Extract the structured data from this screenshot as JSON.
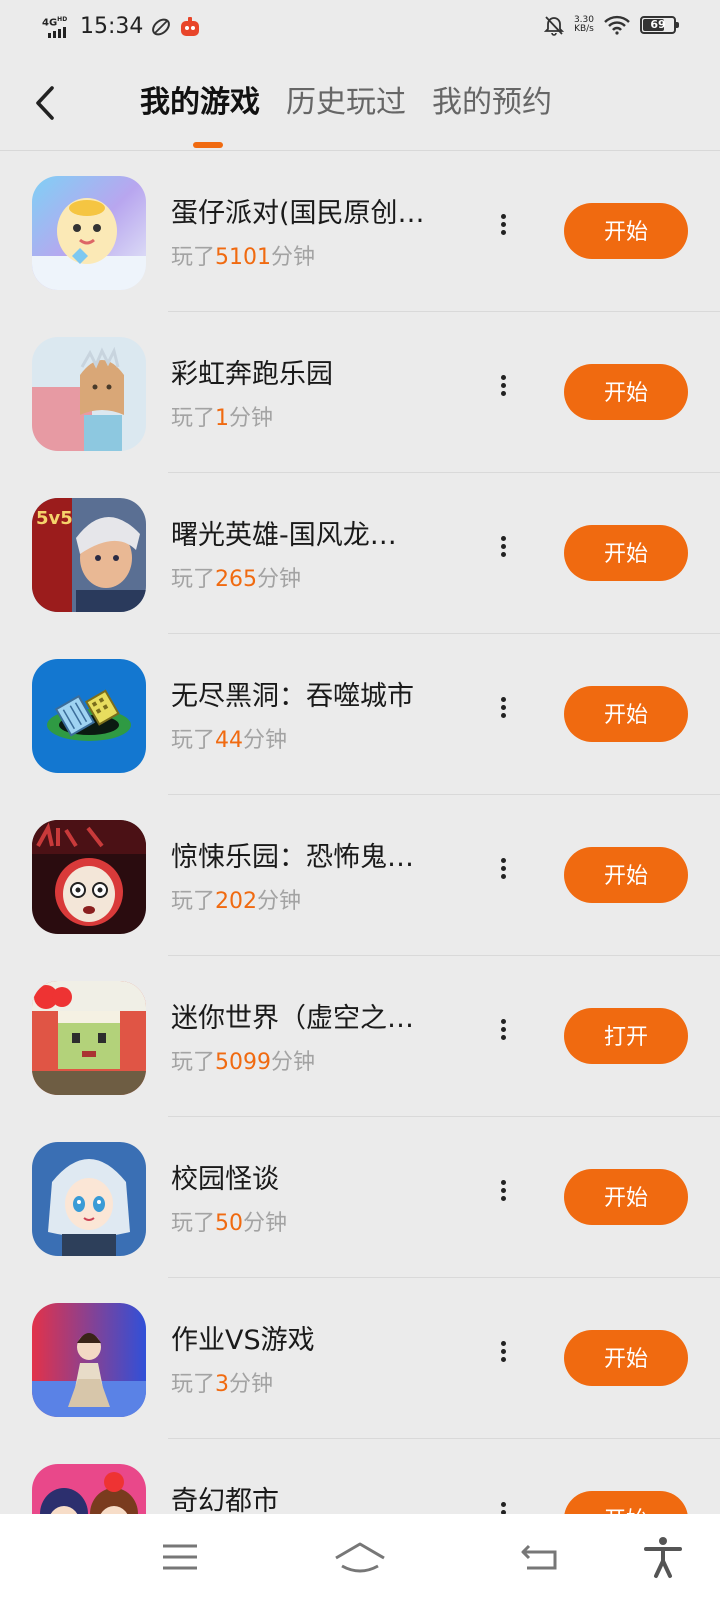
{
  "status_bar": {
    "network": "4G HD",
    "time": "15:34",
    "speed_value": "3.30",
    "speed_unit": "KB/s",
    "battery": "69"
  },
  "header": {
    "tabs": [
      {
        "label": "我的游戏",
        "active": true
      },
      {
        "label": "历史玩过",
        "active": false
      },
      {
        "label": "我的预约",
        "active": false
      }
    ]
  },
  "games": [
    {
      "title": "蛋仔派对(国民原创…",
      "played_prefix": "玩了",
      "minutes": "5101",
      "played_suffix": "分钟",
      "action": "开始",
      "icon": "eggy-party-icon"
    },
    {
      "title": "彩虹奔跑乐园",
      "played_prefix": "玩了",
      "minutes": "1",
      "played_suffix": "分钟",
      "action": "开始",
      "icon": "rainbow-run-icon"
    },
    {
      "title": "曙光英雄-国风龙…",
      "played_prefix": "玩了",
      "minutes": "265",
      "played_suffix": "分钟",
      "action": "开始",
      "icon": "dawn-hero-icon"
    },
    {
      "title": "无尽黑洞：吞噬城市",
      "played_prefix": "玩了",
      "minutes": "44",
      "played_suffix": "分钟",
      "action": "开始",
      "icon": "black-hole-icon"
    },
    {
      "title": "惊悚乐园：恐怖鬼…",
      "played_prefix": "玩了",
      "minutes": "202",
      "played_suffix": "分钟",
      "action": "开始",
      "icon": "horror-park-icon"
    },
    {
      "title": "迷你世界（虚空之…",
      "played_prefix": "玩了",
      "minutes": "5099",
      "played_suffix": "分钟",
      "action": "打开",
      "icon": "mini-world-icon"
    },
    {
      "title": "校园怪谈",
      "played_prefix": "玩了",
      "minutes": "50",
      "played_suffix": "分钟",
      "action": "开始",
      "icon": "campus-tale-icon"
    },
    {
      "title": "作业VS游戏",
      "played_prefix": "玩了",
      "minutes": "3",
      "played_suffix": "分钟",
      "action": "开始",
      "icon": "homework-vs-game-icon"
    },
    {
      "title": "奇幻都市",
      "played_prefix": "",
      "minutes": "",
      "played_suffix": "",
      "action": "开始",
      "icon": "fantasy-city-icon"
    }
  ],
  "colors": {
    "accent": "#f06a10",
    "background": "#ebebeb",
    "meta_text": "#a3a3a3"
  },
  "icon_names": {
    "back": "back-arrow-icon",
    "more": "more-vertical-icon",
    "nav_menu": "menu-icon",
    "nav_home": "home-icon",
    "nav_back": "return-icon",
    "nav_accessibility": "accessibility-icon"
  }
}
